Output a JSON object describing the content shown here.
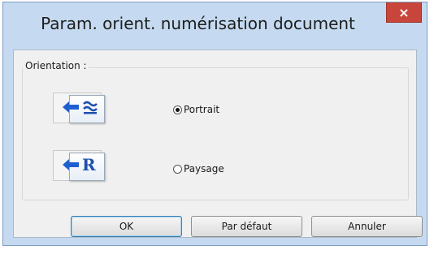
{
  "dialog": {
    "title": "Param. orient. numérisation document",
    "close_label": "×"
  },
  "orientation_group": {
    "label": "Orientation :",
    "options": [
      {
        "label": "Portrait",
        "selected": true,
        "icon": "portrait-orientation-icon"
      },
      {
        "label": "Paysage",
        "selected": false,
        "icon": "landscape-orientation-icon"
      }
    ]
  },
  "buttons": {
    "ok": "OK",
    "default": "Par défaut",
    "cancel": "Annuler"
  },
  "colors": {
    "title_bar": "#c5daf0",
    "close_button": "#c8453c",
    "icon_accent": "#1e4fb0"
  }
}
